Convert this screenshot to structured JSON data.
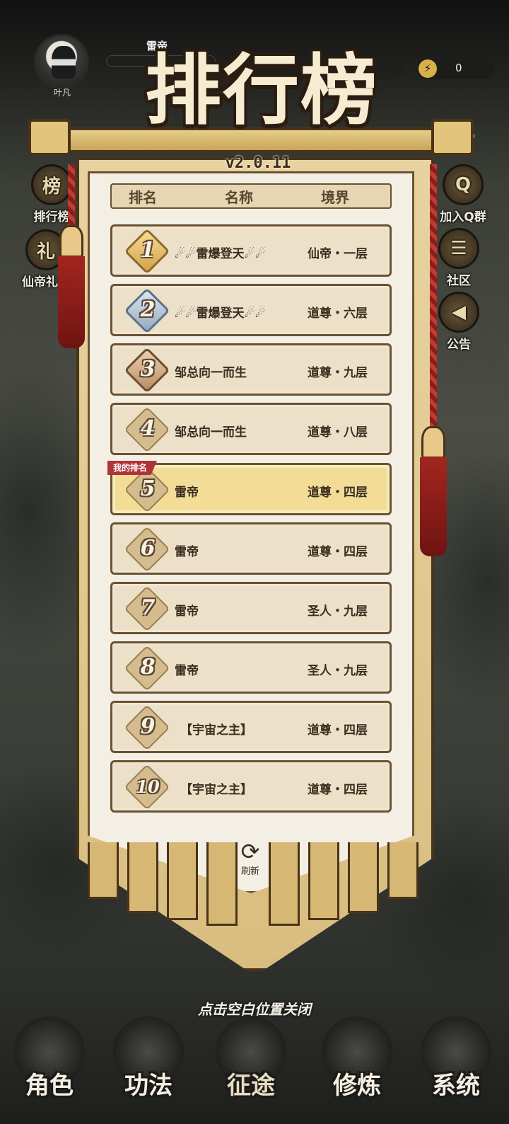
{
  "hud": {
    "avatar_name": "叶凡",
    "player_name": "雷帝",
    "energy_value": "0"
  },
  "side_left": [
    {
      "label": "排行榜",
      "icon": "榜"
    },
    {
      "label": "仙帝礼包",
      "icon": "礼"
    }
  ],
  "side_right": [
    {
      "label": "加入Q群",
      "icon": "Q"
    },
    {
      "label": "社区",
      "icon": "☰"
    },
    {
      "label": "公告",
      "icon": "◀"
    }
  ],
  "panel": {
    "title": "排行榜",
    "version": "v2.0.11",
    "columns": [
      "排名",
      "名称",
      "境界"
    ],
    "my_rank_tag": "我的排名",
    "refresh_label": "刷新",
    "refresh_icon": "⟳"
  },
  "rankings": [
    {
      "rank": "1",
      "name": "☄☄雷爆登天☄☄",
      "realm": "仙帝・一层",
      "tier": "gold"
    },
    {
      "rank": "2",
      "name": "☄☄雷爆登天☄☄",
      "realm": "道尊・六层",
      "tier": "silver"
    },
    {
      "rank": "3",
      "name": "邹总向一而生",
      "realm": "道尊・九层",
      "tier": "bronze"
    },
    {
      "rank": "4",
      "name": "邹总向一而生",
      "realm": "道尊・八层",
      "tier": "plain"
    },
    {
      "rank": "5",
      "name": "雷帝",
      "realm": "道尊・四层",
      "tier": "plain",
      "mine": true
    },
    {
      "rank": "6",
      "name": "雷帝",
      "realm": "道尊・四层",
      "tier": "plain"
    },
    {
      "rank": "7",
      "name": "雷帝",
      "realm": "圣人・九层",
      "tier": "plain"
    },
    {
      "rank": "8",
      "name": "雷帝",
      "realm": "圣人・九层",
      "tier": "plain"
    },
    {
      "rank": "9",
      "name": "【宇宙之主】",
      "realm": "道尊・四层",
      "tier": "plain"
    },
    {
      "rank": "10",
      "name": "【宇宙之主】",
      "realm": "道尊・四层",
      "tier": "plain"
    }
  ],
  "close_hint": "点击空白位置关闭",
  "bottom_nav": [
    {
      "label": "角色",
      "name": "nav-role"
    },
    {
      "label": "功法",
      "name": "nav-skills"
    },
    {
      "label": "征途",
      "name": "nav-journey",
      "active": true
    },
    {
      "label": "修炼",
      "name": "nav-cultivate"
    },
    {
      "label": "系统",
      "name": "nav-system"
    }
  ],
  "colors": {
    "banner_gold": "#e8d3a0",
    "banner_border": "#4a3418",
    "my_rank_highlight": "#f2dc96",
    "tag_red": "#b0323a"
  }
}
